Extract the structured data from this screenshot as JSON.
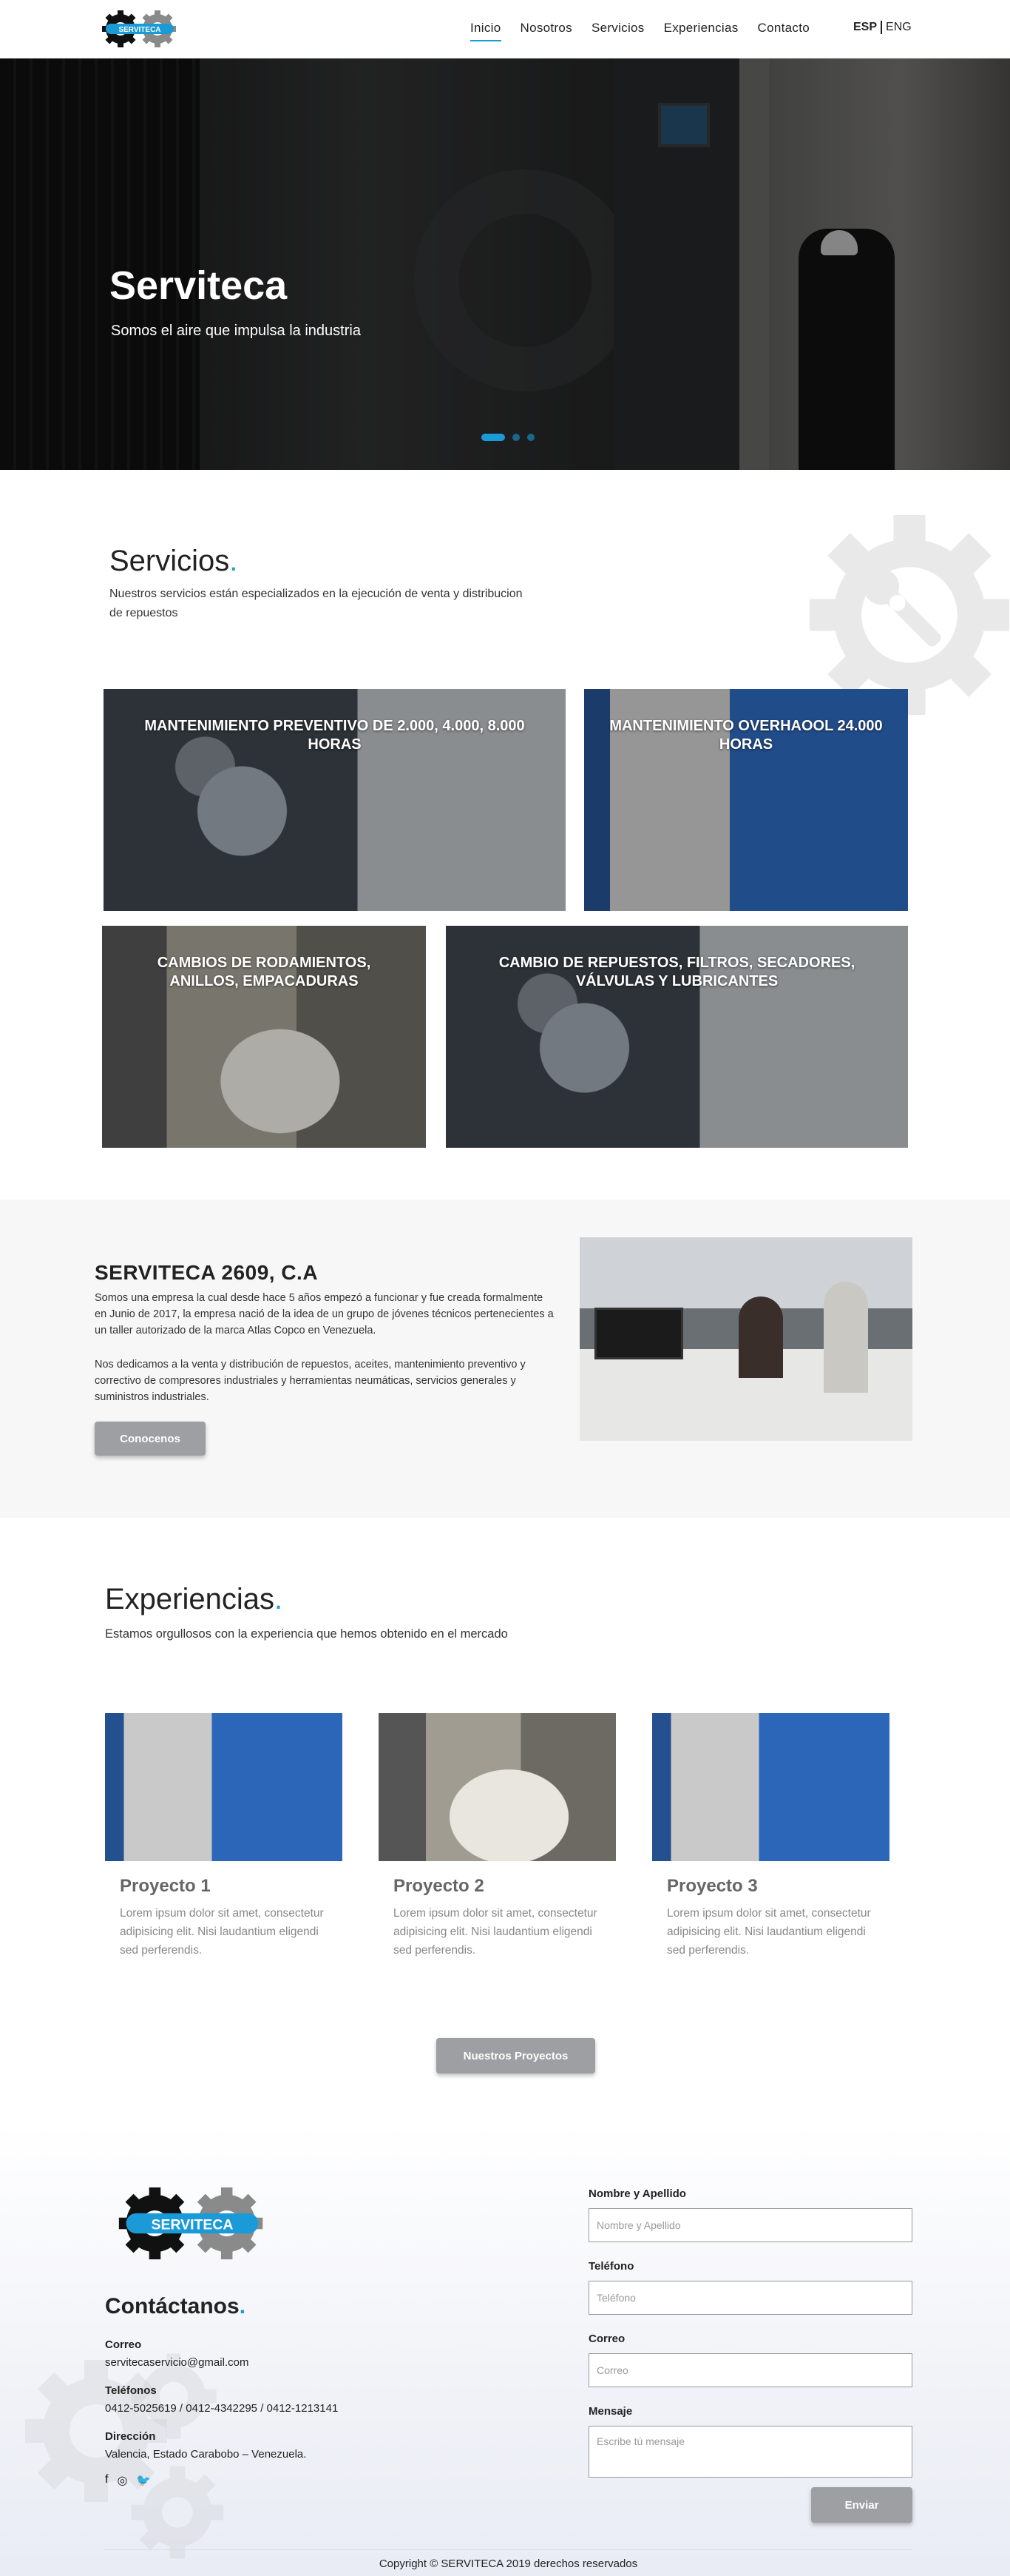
{
  "brand": {
    "logo_text": "SERVITECA",
    "accent": "#1a9ad6"
  },
  "nav": {
    "items": [
      "Inicio",
      "Nosotros",
      "Servicios",
      "Experiencias",
      "Contacto"
    ],
    "lang_esp": "ESP",
    "lang_eng": "ENG"
  },
  "hero": {
    "title": "Serviteca",
    "subtitle": "Somos el aire que impulsa la industria"
  },
  "services": {
    "title": "Servicios",
    "dot": ".",
    "intro": "Nuestros servicios están especializados en la ejecución de venta y distribucion de repuestos",
    "cards": [
      "MANTENIMIENTO PREVENTIVO DE 2.000, 4.000, 8.000 HORAS",
      "MANTENIMIENTO OVERHAOOL 24.000 HORAS",
      "CAMBIOS DE RODAMIENTOS, ANILLOS, EMPACADURAS",
      "CAMBIO DE REPUESTOS, FILTROS, SECADORES, VÁLVULAS Y LUBRICANTES"
    ]
  },
  "about": {
    "title": "SERVITECA 2609, C.A",
    "p1": "Somos una empresa la cual desde hace 5 años empezó a funcionar y fue creada formalmente en Junio de 2017, la empresa nació de la idea de un grupo de jóvenes técnicos pertenecientes a un taller autorizado de la marca Atlas Copco en Venezuela.",
    "p2": "Nos dedicamos a la venta y distribución de repuestos, aceites, mantenimiento preventivo y correctivo de compresores industriales y herramientas neumáticas, servicios generales y suministros industriales.",
    "button": "Conocenos"
  },
  "experiences": {
    "title": "Experiencias",
    "dot": ".",
    "intro": "Estamos orgullosos con la experiencia que hemos obtenido en el mercado",
    "projects": [
      {
        "title": "Proyecto 1",
        "text": "Lorem ipsum dolor sit amet, consectetur adipisicing elit. Nisi laudantium eligendi sed perferendis."
      },
      {
        "title": "Proyecto 2",
        "text": "Lorem ipsum dolor sit amet, consectetur adipisicing elit. Nisi laudantium eligendi sed perferendis."
      },
      {
        "title": "Proyecto 3",
        "text": "Lorem ipsum dolor sit amet, consectetur adipisicing elit. Nisi laudantium eligendi sed perferendis."
      }
    ],
    "button": "Nuestros Proyectos"
  },
  "contact": {
    "title": "Contáctanos",
    "dot": ".",
    "email_label": "Correo",
    "email": "servitecaservicio@gmail.com",
    "phone_label": "Teléfonos",
    "phones": "0412-5025619 / 0412-4342295 / 0412-1213141",
    "address_label": "Dirección",
    "address": "Valencia, Estado Carabobo – Venezuela.",
    "form": {
      "name_label": "Nombre y Apellido",
      "name_placeholder": "Nombre y Apellido",
      "phone_label": "Teléfono",
      "phone_placeholder": "Teléfono",
      "email_label": "Correo",
      "email_placeholder": "Correo",
      "message_label": "Mensaje",
      "message_placeholder": "Escribe tú mensaje",
      "submit": "Enviar"
    }
  },
  "footer": {
    "copyright": "Copyright © SERVITECA 2019 derechos reservados"
  }
}
